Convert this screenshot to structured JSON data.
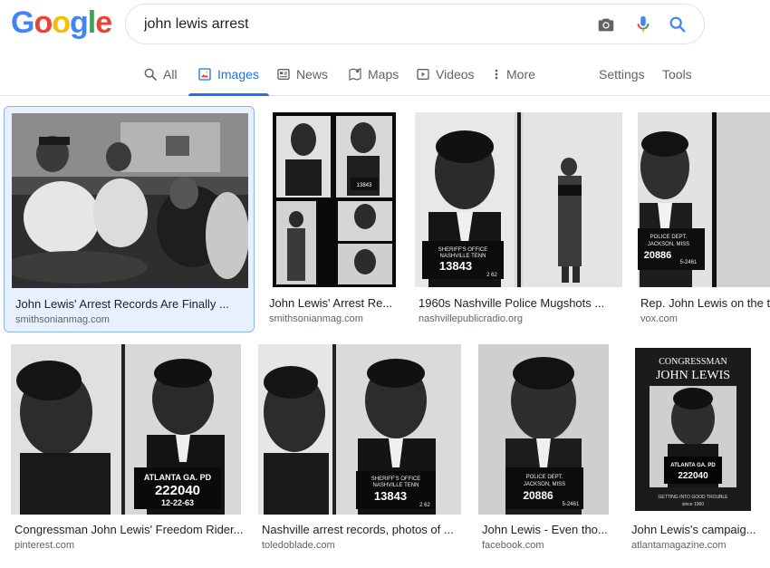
{
  "logo": {
    "letters": [
      "G",
      "o",
      "o",
      "g",
      "l",
      "e"
    ],
    "colors": [
      "#4285f4",
      "#ea4335",
      "#fbbc05",
      "#4285f4",
      "#34a853",
      "#ea4335"
    ]
  },
  "search": {
    "query": "john lewis arrest",
    "camera_icon": "camera-icon",
    "mic_icon": "mic-icon",
    "search_icon": "search-icon"
  },
  "tabs": [
    {
      "label": "All",
      "icon": "search-icon"
    },
    {
      "label": "Images",
      "icon": "image-icon"
    },
    {
      "label": "News",
      "icon": "news-icon"
    },
    {
      "label": "Maps",
      "icon": "map-icon"
    },
    {
      "label": "Videos",
      "icon": "play-icon"
    },
    {
      "label": "More",
      "icon": "more-vert-icon"
    },
    {
      "label": "Settings"
    },
    {
      "label": "Tools"
    }
  ],
  "results": [
    {
      "caption": "John Lewis' Arrest Records Are Finally ...",
      "source": "smithsonianmag.com"
    },
    {
      "caption": "John Lewis' Arrest Re...",
      "source": "smithsonianmag.com"
    },
    {
      "caption": "1960s Nashville Police Mugshots ...",
      "source": "nashvillepublicradio.org"
    },
    {
      "caption": "Rep. John Lewis on the tim",
      "source": "vox.com"
    },
    {
      "caption": "Congressman John Lewis' Freedom Rider...",
      "source": "pinterest.com"
    },
    {
      "caption": "Nashville arrest records, photos of ...",
      "source": "toledoblade.com"
    },
    {
      "caption": "John Lewis - Even tho...",
      "source": "facebook.com"
    },
    {
      "caption": "John Lewis's campaig...",
      "source": "atlantamagazine.com"
    }
  ],
  "image_text": {
    "img2_board_top": "13843",
    "img3_board_line1": "SHERIFF'S OFFICE",
    "img3_board_line2": "NASHVILLE TENN",
    "img3_board_num": "13843",
    "img3_board_date": "2 62",
    "img4_board_line1": "POLICE DEPT.",
    "img4_board_line2": "JACKSON, MISS",
    "img4_board_num": "20886",
    "img4_board_date": "5-2461",
    "img5_board_line1": "ATLANTA GA. PD",
    "img5_board_num": "222040",
    "img5_board_date": "12-22-63",
    "img6_board_line1": "SHERIFF'S OFFICE",
    "img6_board_line2": "NASHVILLE TENN",
    "img6_board_num": "13843",
    "img6_board_date": "2 62",
    "img7_board_line1": "POLICE DEPT.",
    "img7_board_line2": "JACKSON, MISS",
    "img7_board_num": "20886",
    "img7_board_date": "5-2461",
    "img8_title1": "CONGRESSMAN",
    "img8_title2": "JOHN LEWIS",
    "img8_board_line1": "ATLANTA GA. PD",
    "img8_board_num": "222040",
    "img8_sub1": "GETTING INTO GOOD TROUBLE",
    "img8_sub2": "since 1960"
  },
  "colors": {
    "accent": "#1a73e8",
    "selected_bg": "#e8f0fe",
    "selected_border": "#8ab4f8"
  }
}
